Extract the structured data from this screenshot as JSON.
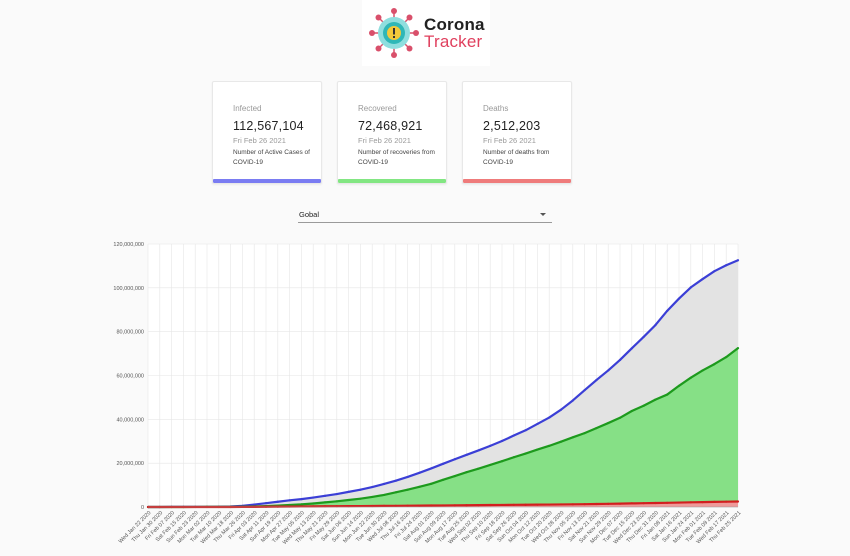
{
  "app": {
    "name_line1": "Corona",
    "name_line2": "Tracker"
  },
  "colors": {
    "infected": "#7a7cf2",
    "recovered": "#82e682",
    "deaths": "#ef7b7b",
    "brand_red": "#e0405e",
    "logo_teal": "#2fb7b7"
  },
  "cards": {
    "infected": {
      "label": "Infected",
      "value": "112,567,104",
      "date": "Fri Feb 26 2021",
      "desc": "Number of Active Cases of COVID-19"
    },
    "recovered": {
      "label": "Recovered",
      "value": "72,468,921",
      "date": "Fri Feb 26 2021",
      "desc": "Number of recoveries from COVID-19"
    },
    "deaths": {
      "label": "Deaths",
      "value": "2,512,203",
      "date": "Fri Feb 26 2021",
      "desc": "Number of deaths from COVID-19"
    }
  },
  "region_select": {
    "value": "Gobal",
    "icon": "caret-down-icon"
  },
  "chart_data": {
    "type": "area",
    "ylim": [
      0,
      120000000
    ],
    "yticks": [
      "0",
      "20,000,000",
      "40,000,000",
      "60,000,000",
      "80,000,000",
      "100,000,000",
      "120,000,000"
    ],
    "x": [
      "Wed Jan 22 2020",
      "Thu Jan 30 2020",
      "Fri Feb 07 2020",
      "Sat Feb 15 2020",
      "Sun Feb 23 2020",
      "Mon Mar 02 2020",
      "Tue Mar 10 2020",
      "Wed Mar 18 2020",
      "Thu Mar 26 2020",
      "Fri Apr 03 2020",
      "Sat Apr 11 2020",
      "Sun Apr 19 2020",
      "Mon Apr 27 2020",
      "Tue May 05 2020",
      "Wed May 13 2020",
      "Thu May 21 2020",
      "Fri May 29 2020",
      "Sat Jun 06 2020",
      "Sun Jun 14 2020",
      "Mon Jun 22 2020",
      "Tue Jun 30 2020",
      "Wed Jul 08 2020",
      "Thu Jul 16 2020",
      "Fri Jul 24 2020",
      "Sat Aug 01 2020",
      "Sun Aug 09 2020",
      "Mon Aug 17 2020",
      "Tue Aug 25 2020",
      "Wed Sep 02 2020",
      "Thu Sep 10 2020",
      "Fri Sep 18 2020",
      "Sat Sep 26 2020",
      "Sun Oct 04 2020",
      "Mon Oct 12 2020",
      "Tue Oct 20 2020",
      "Wed Oct 28 2020",
      "Thu Nov 05 2020",
      "Fri Nov 13 2020",
      "Sat Nov 21 2020",
      "Sun Nov 29 2020",
      "Mon Dec 07 2020",
      "Tue Dec 15 2020",
      "Wed Dec 23 2020",
      "Thu Dec 31 2020",
      "Fri Jan 08 2021",
      "Sat Jan 16 2021",
      "Sun Jan 24 2021",
      "Mon Feb 01 2021",
      "Tue Feb 09 2021",
      "Wed Feb 17 2021",
      "Thu Feb 25 2021"
    ],
    "series": [
      {
        "name": "Infected",
        "values": [
          0,
          0.01,
          0.04,
          0.07,
          0.08,
          0.09,
          0.12,
          0.22,
          0.53,
          1.1,
          1.73,
          2.4,
          3.04,
          3.6,
          4.3,
          5.1,
          5.9,
          6.9,
          7.9,
          9.1,
          10.5,
          12.0,
          13.7,
          15.6,
          17.6,
          19.7,
          21.8,
          23.8,
          25.8,
          27.9,
          30.1,
          32.6,
          35.0,
          37.9,
          40.8,
          44.4,
          48.6,
          53.3,
          57.9,
          62.3,
          67.1,
          72.4,
          77.6,
          83.0,
          89.5,
          95.1,
          100.2,
          104.0,
          107.6,
          110.3,
          112.6
        ]
      },
      {
        "name": "Recovered",
        "values": [
          0,
          0,
          0.01,
          0.01,
          0.02,
          0.05,
          0.07,
          0.08,
          0.13,
          0.22,
          0.4,
          0.65,
          0.92,
          1.2,
          1.6,
          2.1,
          2.6,
          3.2,
          3.8,
          4.6,
          5.5,
          6.7,
          7.9,
          9.2,
          10.6,
          12.4,
          14.1,
          15.9,
          17.5,
          19.2,
          20.9,
          22.7,
          24.4,
          26.2,
          27.9,
          29.8,
          31.8,
          33.7,
          36.0,
          38.3,
          40.7,
          43.8,
          46.2,
          49.0,
          51.3,
          55.3,
          59.0,
          62.3,
          65.2,
          68.4,
          72.5
        ]
      },
      {
        "name": "Deaths",
        "values": [
          0,
          0,
          0,
          0,
          0,
          0,
          0,
          0.01,
          0.02,
          0.05,
          0.1,
          0.16,
          0.2,
          0.25,
          0.29,
          0.33,
          0.37,
          0.4,
          0.43,
          0.47,
          0.51,
          0.55,
          0.59,
          0.63,
          0.68,
          0.72,
          0.77,
          0.81,
          0.86,
          0.91,
          0.95,
          0.99,
          1.04,
          1.08,
          1.12,
          1.17,
          1.22,
          1.29,
          1.36,
          1.45,
          1.54,
          1.64,
          1.73,
          1.82,
          1.92,
          2.03,
          2.14,
          2.24,
          2.33,
          2.43,
          2.51
        ]
      }
    ],
    "values_unit_note": "series values in millions",
    "grid": true,
    "legend": "none"
  }
}
